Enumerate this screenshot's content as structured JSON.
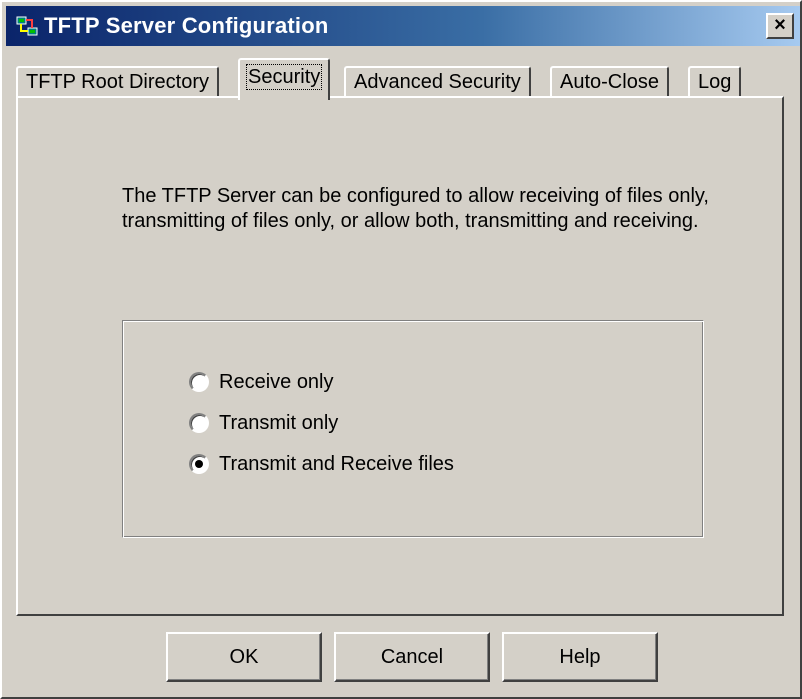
{
  "window": {
    "title": "TFTP Server Configuration",
    "close_label": "×",
    "icon": "tftp-app-icon"
  },
  "tabs": [
    {
      "label": "TFTP Root Directory",
      "active": false
    },
    {
      "label": "Security",
      "active": true
    },
    {
      "label": "Advanced Security",
      "active": false
    },
    {
      "label": "Auto-Close",
      "active": false
    },
    {
      "label": "Log",
      "active": false
    }
  ],
  "security": {
    "description": "The TFTP Server can be configured to allow receiving of files only, transmitting of files only, or allow both, transmitting and receiving.",
    "options": [
      {
        "label": "Receive only",
        "selected": false
      },
      {
        "label": "Transmit only",
        "selected": false
      },
      {
        "label": "Transmit and Receive files",
        "selected": true
      }
    ]
  },
  "buttons": {
    "ok": "OK",
    "cancel": "Cancel",
    "help": "Help"
  },
  "colors": {
    "face": "#d4d0c8",
    "title_start": "#0a246a",
    "title_end": "#a6caf0",
    "highlight": "#ffffff",
    "shadow": "#808080",
    "dark_shadow": "#404040"
  }
}
